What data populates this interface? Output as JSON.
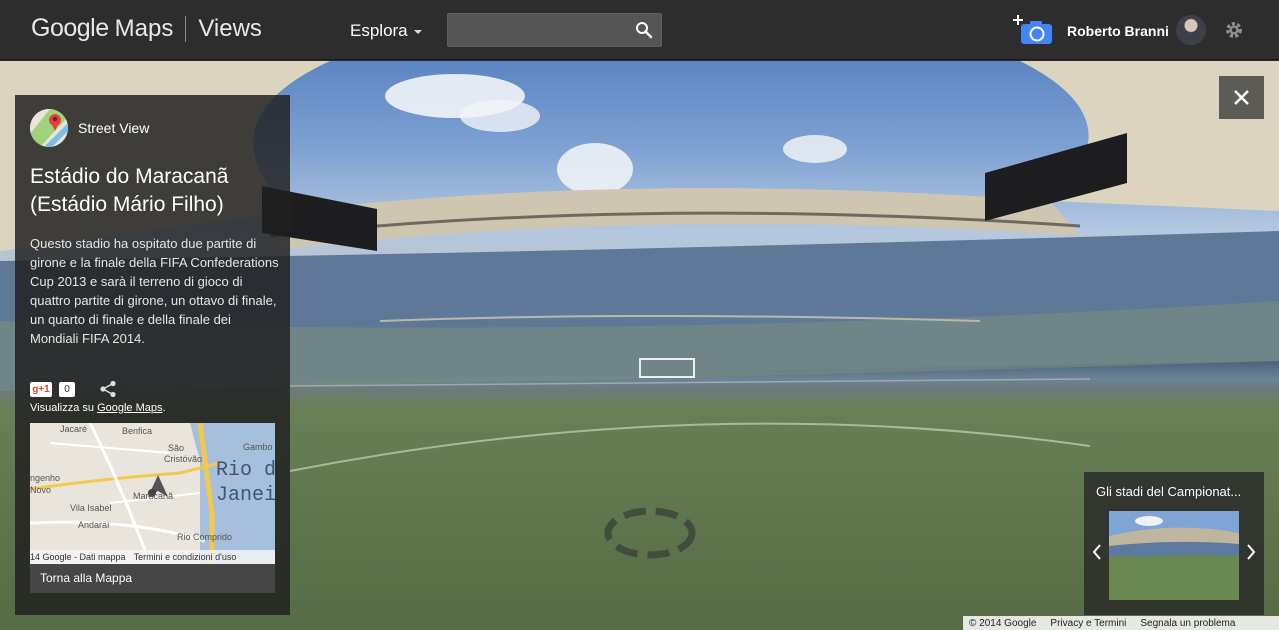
{
  "header": {
    "brand_google": "Google",
    "brand_maps": "Maps",
    "brand_views": "Views",
    "explore_label": "Esplora",
    "search": {
      "value": "",
      "placeholder": ""
    },
    "user_name": "Roberto Branni"
  },
  "panel": {
    "street_view_label": "Street View",
    "title": "Estádio do Maracanã (Estádio Mário Filho)",
    "description": "Questo stadio ha ospitato due partite di girone e la finale della FIFA Confederations Cup 2013 e sarà il terreno di gioco di quattro partite di girone, un ottavo di finale, un quarto di finale e della finale dei Mondiali FIFA 2014.",
    "gplus_label": "g+1",
    "gplus_count": "0",
    "view_on_prefix": "Visualizza su ",
    "view_on_link": "Google Maps",
    "view_on_suffix": ".",
    "map": {
      "labels": [
        "Jacaré",
        "Benfica",
        "São Cristóvão",
        "Gambo",
        "Rio de",
        "Janeir",
        "ngenho Novo",
        "Maracanã",
        "Vila Isabel",
        "Andaraí",
        "Rio Comprido"
      ],
      "attribution": "14 Google - Dati mappa",
      "terms": "Termini e condizioni d'uso"
    },
    "back_label": "Torna alla Mappa"
  },
  "collection": {
    "title": "Gli stadi del Campionat..."
  },
  "footer": {
    "copyright": "© 2014 Google",
    "privacy": "Privacy e Termini",
    "report": "Segnala un problema"
  },
  "colors": {
    "topbar": "#2d2d2d",
    "panel": "#202020",
    "accent_blue": "#4285f4",
    "gplus_red": "#d34836"
  },
  "icons": [
    "search-icon",
    "add-photo-icon",
    "gear-icon",
    "close-icon",
    "share-icon",
    "chevron-left-icon",
    "chevron-right-icon",
    "street-view-logo-icon",
    "navigation-ring-icon"
  ]
}
